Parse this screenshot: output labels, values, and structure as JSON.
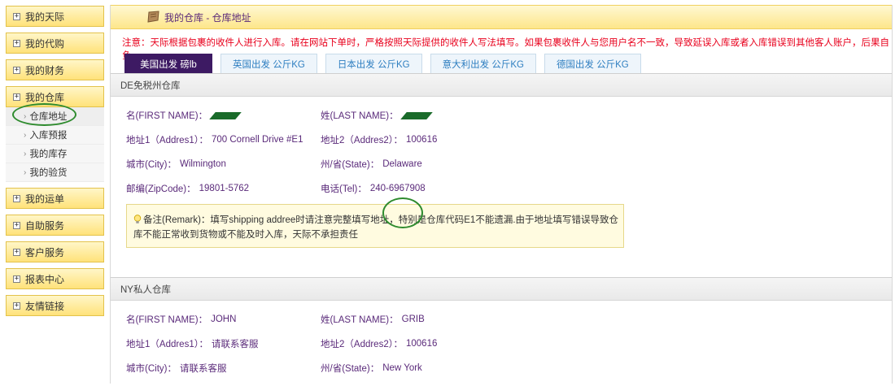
{
  "sidebar": {
    "items": [
      {
        "label": "我的天际"
      },
      {
        "label": "我的代购"
      },
      {
        "label": "我的财务"
      },
      {
        "label": "我的仓库"
      },
      {
        "label": "我的运单"
      },
      {
        "label": "自助服务"
      },
      {
        "label": "客户服务"
      },
      {
        "label": "报表中心"
      },
      {
        "label": "友情链接"
      }
    ],
    "subitems": [
      {
        "label": "仓库地址"
      },
      {
        "label": "入库预报"
      },
      {
        "label": "我的库存"
      },
      {
        "label": "我的验货"
      }
    ]
  },
  "header": {
    "title": "我的仓库 - 仓库地址",
    "notice": "注意：天际根据包裹的收件人进行入库。请在网站下单时，严格按照天际提供的收件人写法填写。如果包裹收件人与您用户名不一致，导致延误入库或者入库错误到其他客人账户，后果自负。"
  },
  "tabs": [
    {
      "label": "美国出发 磅lb"
    },
    {
      "label": "英国出发 公斤KG"
    },
    {
      "label": "日本出发 公斤KG"
    },
    {
      "label": "意大利出发 公斤KG"
    },
    {
      "label": "德国出发 公斤KG"
    }
  ],
  "warehouse1": {
    "name": "DE免税州仓库",
    "first_name_label": "名(FIRST NAME)：",
    "last_name_label": "姓(LAST NAME)：",
    "addr1_label": "地址1（Addres1）：",
    "addr1": "700 Cornell Drive #E1",
    "addr2_label": "地址2（Addres2）：",
    "addr2": "100616",
    "city_label": "城市(City)：",
    "city": "Wilmington",
    "state_label": "州/省(State)：",
    "state": "Delaware",
    "zip_label": "邮编(ZipCode)：",
    "zip": "19801-5762",
    "tel_label": "电话(Tel)：",
    "tel": "240-6967908",
    "remark": "备注(Remark)：填写shipping addree时请注意完整填写地址，特别是仓库代码E1不能遗漏.由于地址填写错误导致仓库不能正常收到货物或不能及时入库，天际不承担责任"
  },
  "warehouse2": {
    "name": "NY私人仓库",
    "first_name_label": "名(FIRST NAME)：",
    "first_name": "JOHN",
    "last_name_label": "姓(LAST NAME)：",
    "last_name": "GRIB",
    "addr1_label": "地址1（Addres1）：",
    "addr1": "请联系客服",
    "addr2_label": "地址2（Addres2）：",
    "addr2": "100616",
    "city_label": "城市(City)：",
    "city": "请联系客服",
    "state_label": "州/省(State)：",
    "state": "New York"
  },
  "colors": {
    "accent_purple": "#3d1a63",
    "notice_red": "#e8001c",
    "label_purple": "#5a2a7a",
    "annotation_green": "#2e8b2e"
  }
}
